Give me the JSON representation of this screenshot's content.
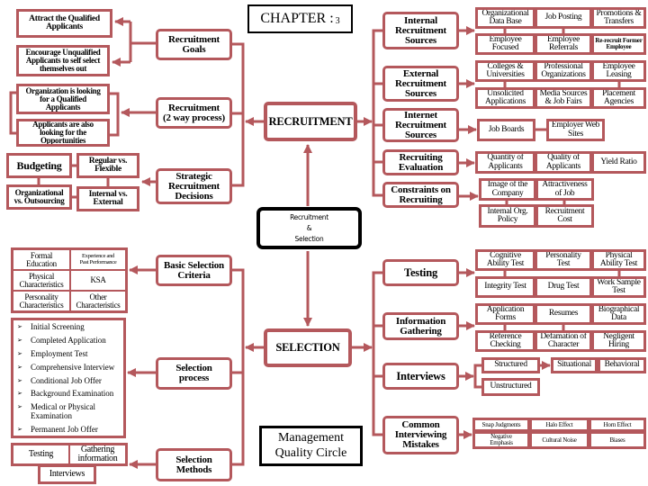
{
  "colors": {
    "accent": "#b4585c",
    "hub_border": "#000000"
  },
  "icons": {
    "list_bullet": "arrow-bullet",
    "bullet_glyph": "➢"
  },
  "chapter": {
    "label": "CHAPTER :",
    "number": "3"
  },
  "hub": "Recruitment\n&\nSelection",
  "quality_circle": "Management\nQuality Circle",
  "recruitment": {
    "title": "RECRUITMENT",
    "left": [
      {
        "label": "Recruitment\nGoals",
        "items": [
          "Attract the Qualified\nApplicants",
          "Encourage Unqualified\nApplicants to self select\nthemselves out"
        ]
      },
      {
        "label": "Recruitment\n(2 way process)",
        "items": [
          "Organization is looking\nfor a  Qualified\nApplicants",
          "Applicants are also\nlooking for the\nOpportunities"
        ]
      },
      {
        "label": "Strategic\nRecruitment\nDecisions",
        "items": [
          "Budgeting",
          "Regular vs.\nFlexible",
          "Organizational\nvs. Outsourcing",
          "Internal vs.\nExternal"
        ]
      }
    ],
    "right": [
      {
        "label": "Internal\nRecruitment\nSources",
        "items": [
          "Organizational\nData Base",
          "Job Posting",
          "Promotions &\nTransfers",
          "Employee\nFocused",
          "Employee\nReferrals",
          "Re-recruit Former\nEmployee"
        ]
      },
      {
        "label": "External\nRecruitment\nSources",
        "items": [
          "Colleges &\nUniversities",
          "Professional\nOrganizations",
          "Employee\nLeasing",
          "Unsolicited\nApplications",
          "Media Sources\n& Job Fairs",
          "Placement\nAgencies"
        ]
      },
      {
        "label": "Internet\nRecruitment\nSources",
        "items": [
          "Job Boards",
          "Employer Web\nSites"
        ]
      },
      {
        "label": "Recruiting\nEvaluation",
        "items": [
          "Quantity of\nApplicants",
          "Quality of\nApplicants",
          "Yield Ratio"
        ]
      },
      {
        "label": "Constraints on\nRecruiting",
        "items": [
          "Image of the\nCompany",
          "Attractiveness\nof Job",
          "Internal Org.\nPolicy",
          "Recruitment\nCost"
        ]
      }
    ]
  },
  "selection": {
    "title": "SELECTION",
    "left": [
      {
        "label": "Basic Selection\nCriteria",
        "items": [
          "Formal\nEducation",
          "Experience and\nPast Performance",
          "Physical\nCharacteristics",
          "KSA",
          "Personality\nCharacteristics",
          "Other\nCharacteristics"
        ]
      },
      {
        "label": "Selection\nprocess",
        "items": [
          "Initial Screening",
          "Completed Application",
          "Employment Test",
          "Comprehensive Interview",
          "Conditional Job Offer",
          "Background Examination",
          "Medical or Physical\nExamination",
          "Permanent Job Offer"
        ]
      },
      {
        "label": "Selection\nMethods",
        "items": [
          "Testing",
          "Gathering\ninformation",
          "Interviews"
        ]
      }
    ],
    "right": [
      {
        "label": "Testing",
        "items": [
          "Cognitive\nAbility Test",
          "Personality\nTest",
          "Physical\nAbility Test",
          "Integrity Test",
          "Drug Test",
          "Work Sample\nTest"
        ]
      },
      {
        "label": "Information\nGathering",
        "items": [
          "Application\nForms",
          "Resumes",
          "Biographical\nData",
          "Reference\nChecking",
          "Defamation of\nCharacter",
          "Negligent\nHiring"
        ]
      },
      {
        "label": "Interviews",
        "items": [
          "Structured",
          "Unstructured"
        ],
        "structured_types": [
          "Situational",
          "Behavioral"
        ]
      },
      {
        "label": "Common\nInterviewing\nMistakes",
        "items": [
          "Snap Judgments",
          "Halo Effect",
          "Horn Effect",
          "Negative\nEmphasis",
          "Cultural Noise",
          "Biases"
        ]
      }
    ]
  }
}
